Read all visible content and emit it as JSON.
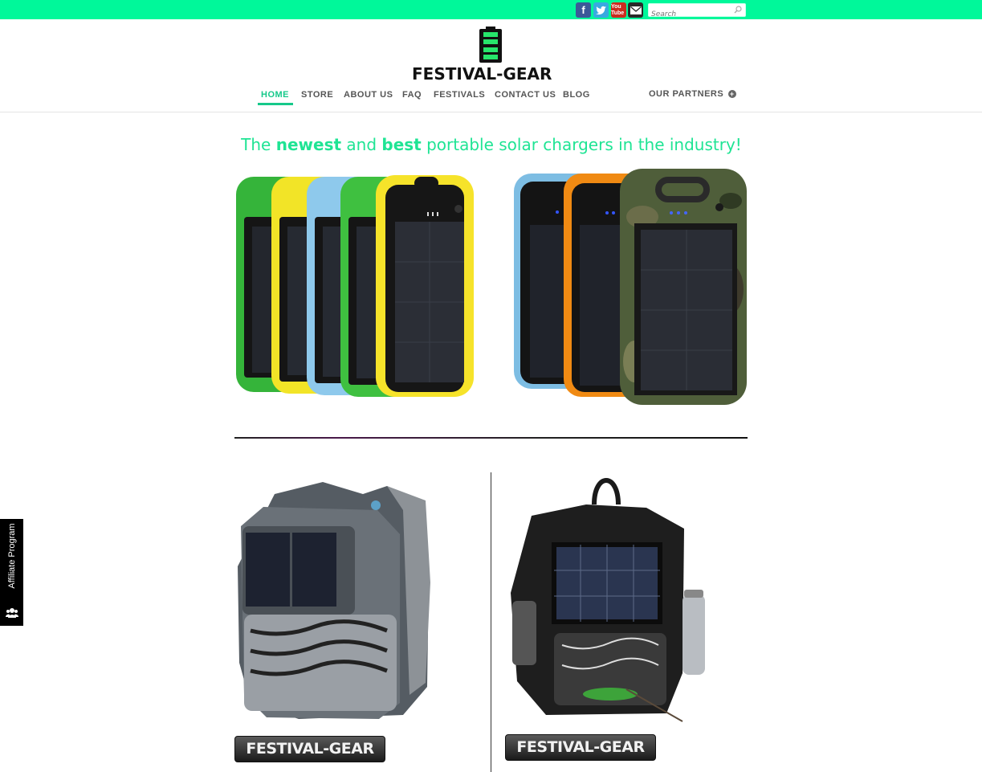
{
  "topbar": {
    "social": [
      "facebook-icon",
      "twitter-icon",
      "youtube-icon",
      "email-icon"
    ],
    "youtube_text": "You Tube",
    "search_placeholder": "Search"
  },
  "logo": {
    "text": "FESTIVAL-GEAR"
  },
  "nav": {
    "items": [
      {
        "label": "HOME",
        "active": true
      },
      {
        "label": "STORE"
      },
      {
        "label": "ABOUT US"
      },
      {
        "label": "FAQ"
      },
      {
        "label": "FESTIVALS"
      },
      {
        "label": "CONTACT US"
      },
      {
        "label": "BLOG"
      }
    ],
    "partners_label": "OUR PARTNERS"
  },
  "tagline": {
    "part1": "The ",
    "bold1": "newest",
    "part2": " and ",
    "bold2": "best",
    "part3": " portable solar chargers in the industry!"
  },
  "products": {
    "badge_left": "FESTIVAL-GEAR",
    "badge_right": "FESTIVAL-GEAR"
  },
  "affiliate": {
    "label": "Affiliate Program"
  },
  "colors": {
    "topbar": "#00f89a",
    "accent": "#16c98a",
    "tagline": "#1fe494"
  }
}
